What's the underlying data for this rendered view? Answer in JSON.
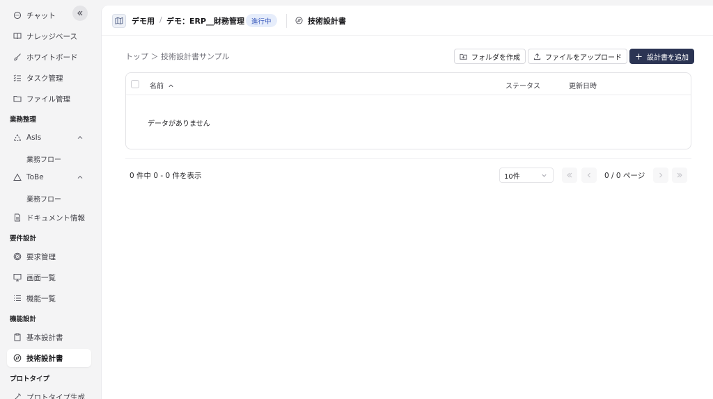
{
  "sidebar": {
    "items_top": [
      {
        "label": "チャット",
        "icon": "chat-icon"
      },
      {
        "label": "ナレッジベース",
        "icon": "book-icon"
      },
      {
        "label": "ホワイトボード",
        "icon": "brush-icon"
      },
      {
        "label": "タスク管理",
        "icon": "task-list-icon"
      },
      {
        "label": "ファイル管理",
        "icon": "folder-icon"
      }
    ],
    "section_business": "業務整理",
    "asis_label": "AsIs",
    "asis_sub": "業務フロー",
    "tobe_label": "ToBe",
    "tobe_sub": "業務フロー",
    "document_info": "ドキュメント情報",
    "section_requirements": "要件設計",
    "requirements_items": [
      {
        "label": "要求管理",
        "icon": "target-icon"
      },
      {
        "label": "画面一覧",
        "icon": "monitor-icon"
      },
      {
        "label": "機能一覧",
        "icon": "list-icon"
      }
    ],
    "section_function": "機能設計",
    "basic_design": "基本設計書",
    "tech_design": "技術設計書",
    "section_prototype": "プロトタイプ",
    "prototype_gen": "プロトタイプ生成"
  },
  "header": {
    "project": "デモ用",
    "separator": "/",
    "subproject": "デモ：ERP__財務管理",
    "status": "進行中",
    "document": "技術設計書"
  },
  "breadcrumb": "トップ ＞ 技術設計書サンプル",
  "toolbar": {
    "create_folder": "フォルダを作成",
    "upload_file": "ファイルをアップロード",
    "add_design": "設計書を追加"
  },
  "table": {
    "col_name": "名前",
    "col_status": "ステータス",
    "col_updated": "更新日時",
    "empty": "データがありません"
  },
  "pagination": {
    "count_text": "0 件中 0 - 0 件を表示",
    "per_page": "10件",
    "page_text": "0 / 0 ページ"
  }
}
